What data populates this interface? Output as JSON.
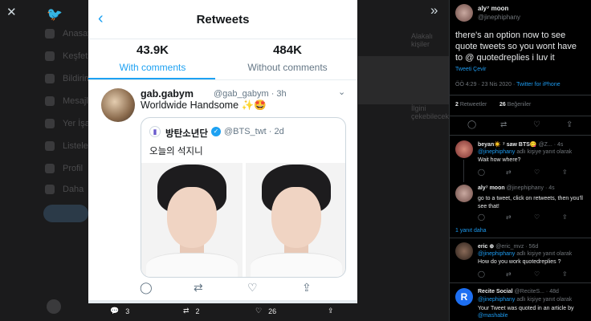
{
  "viewer": {
    "close_glyph": "✕",
    "expand_glyph": "»"
  },
  "background": {
    "nav_items": [
      "Anasayfa",
      "Keşfet",
      "Bildirimler",
      "Mesajlar",
      "Yer İşaretleri",
      "Listeler",
      "Profil",
      "Daha"
    ],
    "right_title": "Alakalı kişiler",
    "right_sub": "İlgini çekebilecek",
    "actions": {
      "replies": "3",
      "retweets": "2",
      "likes": "26"
    }
  },
  "modal": {
    "title": "Retweets",
    "back_glyph": "‹",
    "tabs": [
      {
        "count": "43.9K",
        "label": "With comments",
        "active": true
      },
      {
        "count": "484K",
        "label": "Without comments",
        "active": false
      }
    ],
    "tweet": {
      "name": "gab.gabym",
      "handle": "@gab_gabym · 3h",
      "text": "Worldwide Handsome ✨🤩",
      "quote": {
        "name": "방탄소년단",
        "handle": "@BTS_twt · 2d",
        "text": "오늘의 석지니"
      }
    }
  },
  "panel": {
    "author": {
      "name": "aly⁷ moon",
      "handle": "@jinephiphany"
    },
    "text": "there's an option now to see quote tweets so you wont have to @ quotedreplies i luv it",
    "translate": "Tweeti Çevir",
    "meta": "ÖÖ 4:29 · 23 Nis 2020 · ",
    "source": "Twitter for iPhone",
    "retweets_count": "2",
    "retweets_label": "Retweetler",
    "likes_count": "26",
    "likes_label": "Beğeniler",
    "replies": [
      {
        "name": "beyan☀️ ⁷ saw BTS😋",
        "handle": "@Z... · 4s",
        "reply_to": "@jinephiphany",
        "reply_suffix": "adlı kişiye yanıt olarak",
        "text": "Wait how where?"
      },
      {
        "name": "aly⁷ moon",
        "handle": "@jinephiphany · 4s",
        "reply_to": "",
        "reply_suffix": "",
        "text": "go to a tweet, click on retweets, then you'll see that!",
        "more": "1 yanıt daha"
      },
      {
        "name": "eric ⊕",
        "handle": "@eric_mvz · 56d",
        "reply_to": "@jinephiphany",
        "reply_suffix": "adlı kişiye yanıt olarak",
        "text": "How do you work quotedreplies ?"
      },
      {
        "name": "Recite Social",
        "handle": "@ReciteS... · 48d",
        "reply_to": "@jinephiphany",
        "reply_suffix": "adlı kişiye yanıt olarak",
        "text": "Your Tweet was quoted in an article by ",
        "text_link": "@mashable"
      }
    ]
  }
}
